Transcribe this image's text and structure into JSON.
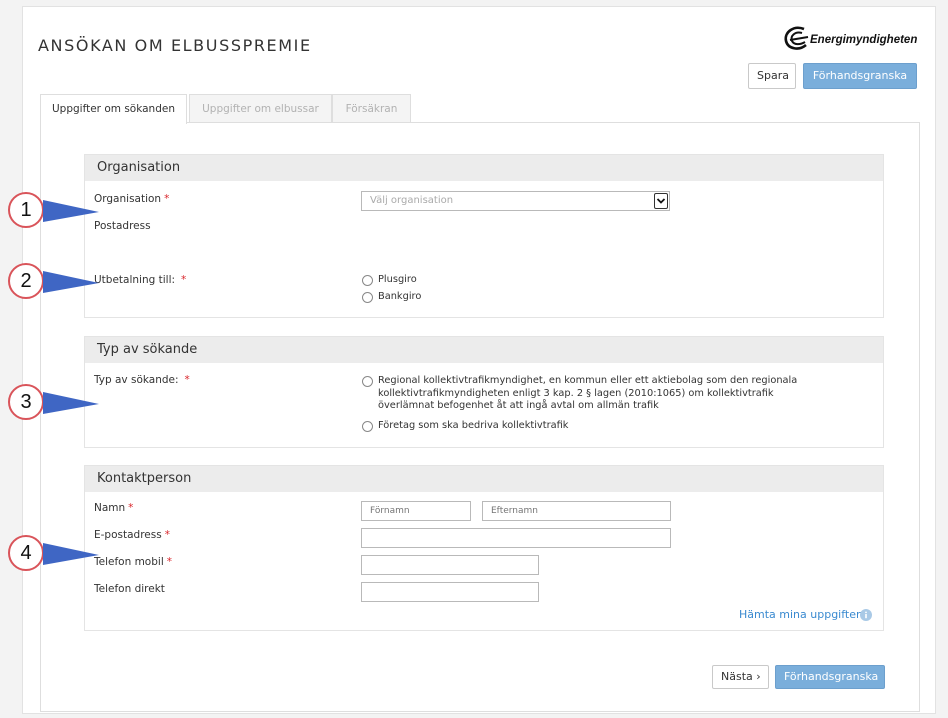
{
  "header": {
    "title": "ANSÖKAN OM ELBUSSPREMIE",
    "logo_text": "Energimyndigheten",
    "spara_label": "Spara",
    "preview_label": "Förhandsgranska"
  },
  "tabs": [
    {
      "label": "Uppgifter om sökanden",
      "active": true
    },
    {
      "label": "Uppgifter om elbussar",
      "active": false
    },
    {
      "label": "Försäkran",
      "active": false
    }
  ],
  "organisation": {
    "heading": "Organisation",
    "org_label": "Organisation",
    "select_placeholder": "Välj organisation",
    "postadress_label": "Postadress",
    "payout_label": "Utbetalning till:",
    "payout_options": [
      "Plusgiro",
      "Bankgiro"
    ]
  },
  "applicant_type": {
    "heading": "Typ av sökande",
    "label": "Typ av sökande:",
    "option1": "Regional kollektivtrafikmyndighet, en kommun eller ett aktiebolag som den regionala kollektivtrafikmyndigheten enligt 3 kap. 2 § lagen (2010:1065) om kollektivtrafik överlämnat befogenhet åt att ingå avtal om allmän trafik",
    "option2": "Företag som ska bedriva kollektivtrafik"
  },
  "contact": {
    "heading": "Kontaktperson",
    "name_label": "Namn",
    "firstname_placeholder": "Förnamn",
    "lastname_placeholder": "Efternamn",
    "email_label": "E-postadress",
    "mobile_label": "Telefon mobil",
    "direct_label": "Telefon direkt",
    "fetch_link": "Hämta mina uppgifter"
  },
  "footer": {
    "next_label": "Nästa ›",
    "preview_label": "Förhandsgranska"
  },
  "callouts": [
    "1",
    "2",
    "3",
    "4"
  ],
  "required_marker": "*",
  "colors": {
    "primary_button": "#7aaedb",
    "required": "#d9252b",
    "callout_arrow": "#3f66c4",
    "callout_ring": "#d9545a",
    "link": "#3a8ad0"
  }
}
